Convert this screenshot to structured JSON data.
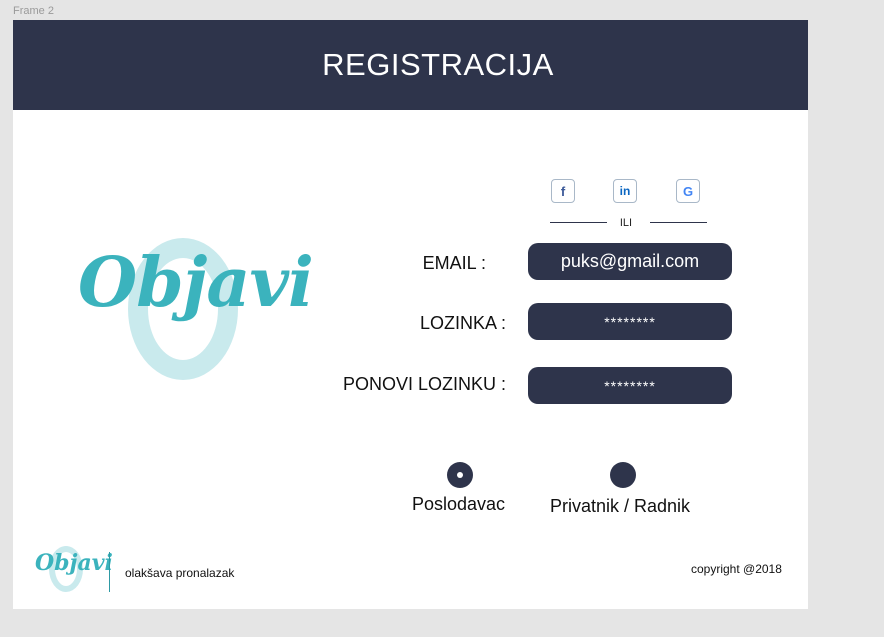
{
  "frame_label": "Frame 2",
  "header": {
    "title": "REGISTRACIJA"
  },
  "logo": {
    "text": "Objavi"
  },
  "social": {
    "facebook_glyph": "f",
    "linkedin_glyph": "in",
    "google_glyph": "G",
    "divider_text": "ILI"
  },
  "form": {
    "email_label": "EMAIL :",
    "email_value": "puks@gmail.com",
    "password_label": "LOZINKA :",
    "password_value": "********",
    "repeat_password_label": "PONOVI LOZINKU :",
    "repeat_password_value": "********"
  },
  "role": {
    "employer_label": "Poslodavac",
    "worker_label": "Privatnik / Radnik",
    "selected": "Poslodavac"
  },
  "footer": {
    "logo_text": "Objavi",
    "tagline": "olakšava pronalazak",
    "copyright": "copyright @2018"
  },
  "colors": {
    "navy": "#2e344b",
    "teal": "#3bb3bd",
    "teal_light": "#c9eaed"
  }
}
